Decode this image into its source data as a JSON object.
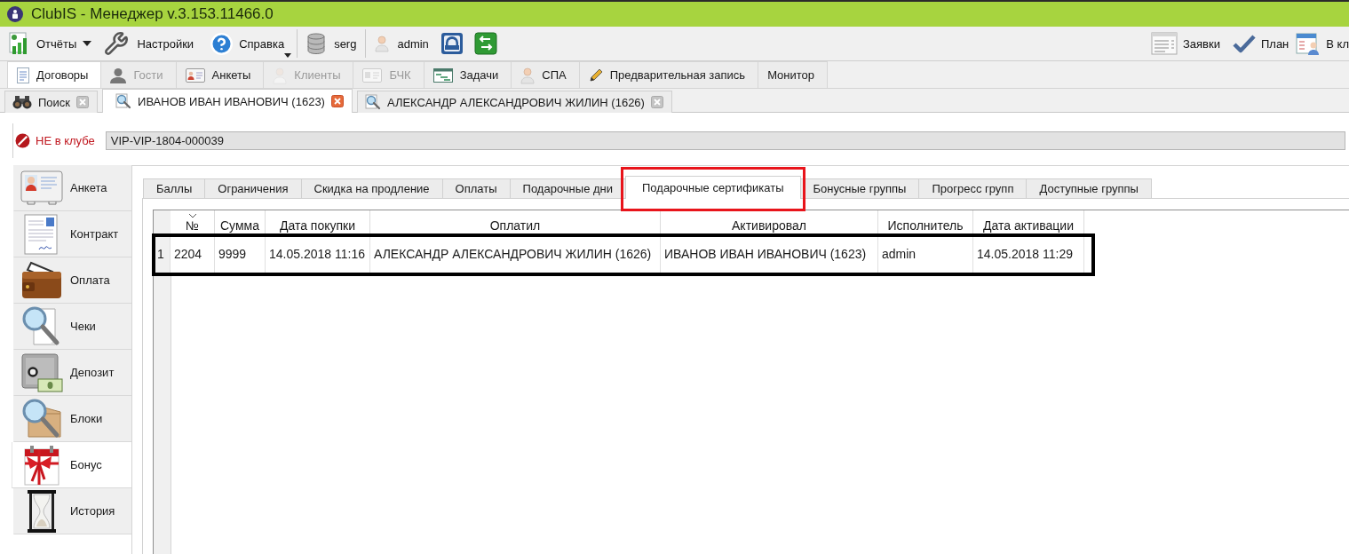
{
  "window": {
    "title": "ClubIS - Менеджер v.3.153.11466.0"
  },
  "toolbar": {
    "groups": [
      [
        {
          "kind": "dropdown",
          "label": "Отчёты"
        },
        {
          "kind": "button",
          "label": "Настройки"
        },
        {
          "kind": "split",
          "label": "Справка"
        }
      ],
      [
        {
          "kind": "button",
          "label": "serg"
        }
      ],
      [
        {
          "kind": "button",
          "label": "admin"
        },
        {
          "kind": "icon"
        },
        {
          "kind": "icon"
        }
      ]
    ],
    "right": [
      {
        "label": "Заявки"
      },
      {
        "label": "План"
      },
      {
        "label": "В кл"
      }
    ]
  },
  "module_tabs": [
    {
      "label": "Договоры",
      "selected": true,
      "disabled": false
    },
    {
      "label": "Гости",
      "selected": false,
      "disabled": true
    },
    {
      "label": "Анкеты",
      "selected": false,
      "disabled": false
    },
    {
      "label": "Клиенты",
      "selected": false,
      "disabled": true
    },
    {
      "label": "БЧК",
      "selected": false,
      "disabled": true
    },
    {
      "label": "Задачи",
      "selected": false,
      "disabled": false
    },
    {
      "label": "СПА",
      "selected": false,
      "disabled": false
    },
    {
      "label": "Предварительная запись",
      "selected": false,
      "disabled": false
    },
    {
      "label": "Монитор",
      "selected": false,
      "disabled": false
    }
  ],
  "document_tabs": [
    {
      "label": "Поиск",
      "selected": false
    },
    {
      "label": "ИВАНОВ ИВАН ИВАНОВИЧ (1623)",
      "selected": true
    },
    {
      "label": "АЛЕКСАНДР АЛЕКСАНДРОВИЧ ЖИЛИН (1626)",
      "selected": false
    }
  ],
  "client": {
    "status": "НЕ в клубе",
    "in_club": false,
    "card_number": "VIP-VIP-1804-000039"
  },
  "sidebar": {
    "items": [
      {
        "label": "Анкета",
        "selected": false
      },
      {
        "label": "Контракт",
        "selected": false
      },
      {
        "label": "Оплата",
        "selected": false
      },
      {
        "label": "Чеки",
        "selected": false
      },
      {
        "label": "Депозит",
        "selected": false
      },
      {
        "label": "Блоки",
        "selected": false
      },
      {
        "label": "Бонус",
        "selected": true
      },
      {
        "label": "История",
        "selected": false
      }
    ]
  },
  "bonus_tabs": [
    {
      "label": "Баллы",
      "selected": false,
      "highlighted": false
    },
    {
      "label": "Ограничения",
      "selected": false,
      "highlighted": false
    },
    {
      "label": "Скидка на продление",
      "selected": false,
      "highlighted": false
    },
    {
      "label": "Оплаты",
      "selected": false,
      "highlighted": false
    },
    {
      "label": "Подарочные дни",
      "selected": false,
      "highlighted": false
    },
    {
      "label": "Подарочные сертификаты",
      "selected": true,
      "highlighted": true
    },
    {
      "label": "Бонусные группы",
      "selected": false,
      "highlighted": false
    },
    {
      "label": "Прогресс групп",
      "selected": false,
      "highlighted": false
    },
    {
      "label": "Доступные группы",
      "selected": false,
      "highlighted": false
    }
  ],
  "certificates": {
    "columns": [
      {
        "label": "№",
        "sorted": true
      },
      {
        "label": "Сумма",
        "sorted": false
      },
      {
        "label": "Дата покупки",
        "sorted": false
      },
      {
        "label": "Оплатил",
        "sorted": false
      },
      {
        "label": "Активировал",
        "sorted": false
      },
      {
        "label": "Исполнитель",
        "sorted": false
      },
      {
        "label": "Дата активации",
        "sorted": false
      }
    ],
    "rows": [
      {
        "number": "1",
        "highlighted": true,
        "cells": [
          "2204",
          "9999",
          "14.05.2018 11:16",
          "АЛЕКСАНДР АЛЕКСАНДРОВИЧ ЖИЛИН (1626)",
          "ИВАНОВ ИВАН ИВАНОВИЧ (1623)",
          "admin",
          "14.05.2018 11:29"
        ]
      }
    ]
  }
}
